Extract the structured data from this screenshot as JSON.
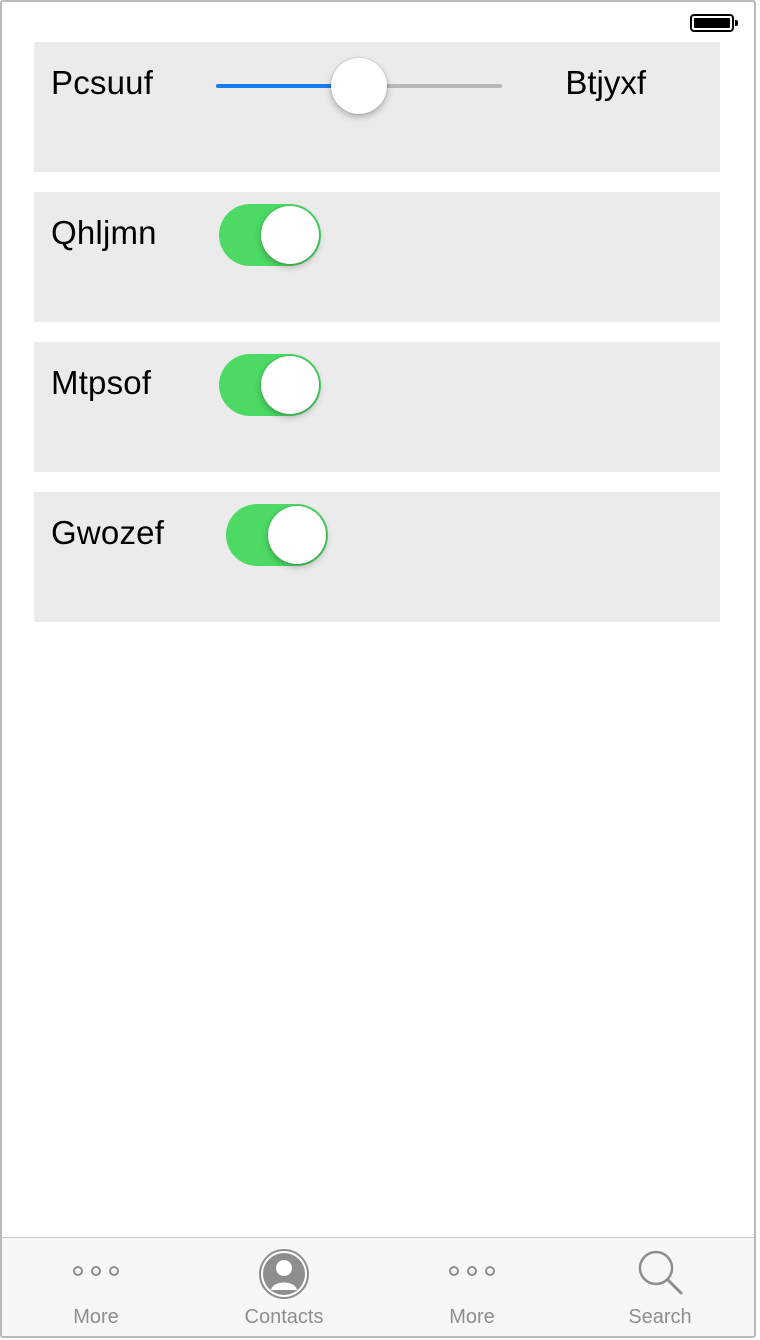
{
  "status_bar": {
    "battery_icon": "battery-full-icon"
  },
  "slider_row": {
    "left_label": "Pcsuuf",
    "right_label": "Btjyxf",
    "value_fraction": 0.5,
    "colors": {
      "min_track": "#1b7cf2",
      "max_track": "#b7b7b7"
    }
  },
  "toggle_rows": [
    {
      "label": "Qhljmn",
      "on": true
    },
    {
      "label": "Mtpsof",
      "on": true
    },
    {
      "label": "Gwozef",
      "on": true
    }
  ],
  "toggle_color_on": "#4cd964",
  "tab_bar": {
    "tabs": [
      {
        "label": "More",
        "icon": "more-dots-icon"
      },
      {
        "label": "Contacts",
        "icon": "contacts-person-icon"
      },
      {
        "label": "More",
        "icon": "more-dots-icon"
      },
      {
        "label": "Search",
        "icon": "search-icon"
      }
    ]
  }
}
